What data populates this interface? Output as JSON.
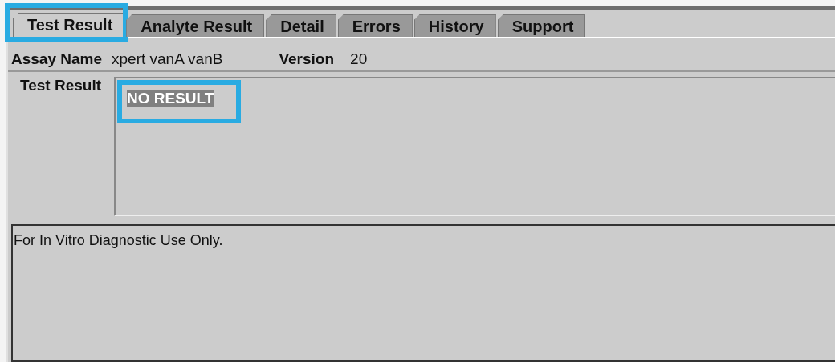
{
  "tabs": [
    {
      "label": "Test Result",
      "selected": true,
      "highlighted": true
    },
    {
      "label": "Analyte Result",
      "selected": false,
      "highlighted": false
    },
    {
      "label": "Detail",
      "selected": false,
      "highlighted": false
    },
    {
      "label": "Errors",
      "selected": false,
      "highlighted": false
    },
    {
      "label": "History",
      "selected": false,
      "highlighted": false
    },
    {
      "label": "Support",
      "selected": false,
      "highlighted": false
    }
  ],
  "assay": {
    "label": "Assay Name",
    "value": "xpert vanA vanB",
    "version_label": "Version",
    "version": "20"
  },
  "test_result": {
    "label": "Test Result",
    "value": "NO RESULT",
    "highlighted": true
  },
  "notice": "For In Vitro Diagnostic Use Only."
}
